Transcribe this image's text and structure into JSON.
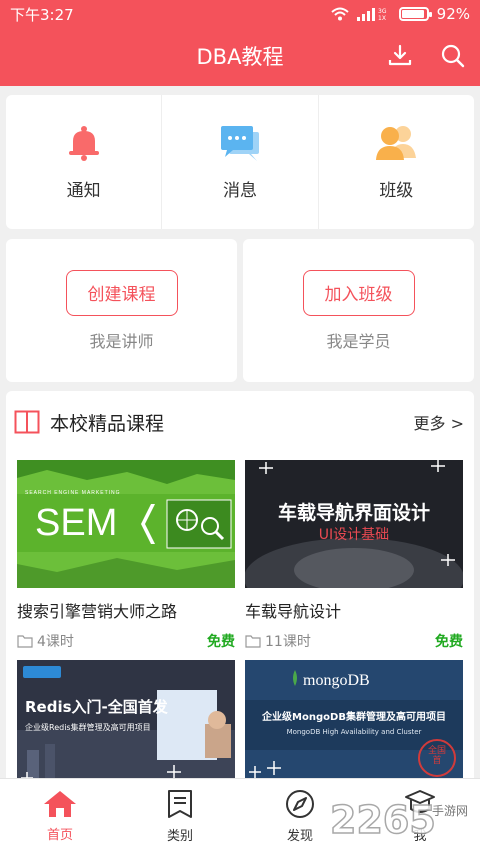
{
  "status": {
    "time": "下午3:27",
    "battery": "92%",
    "battery_level": 0.92
  },
  "header": {
    "title": "DBA教程",
    "download_icon": "download-icon",
    "search_icon": "search-icon"
  },
  "quick": [
    {
      "label": "通知",
      "icon": "bell-icon",
      "color": "#f96a6a"
    },
    {
      "label": "消息",
      "icon": "chat-icon",
      "color": "#5bb4f0"
    },
    {
      "label": "班级",
      "icon": "users-icon",
      "color": "#f9b04b"
    }
  ],
  "roles": [
    {
      "button": "创建课程",
      "sub": "我是讲师"
    },
    {
      "button": "加入班级",
      "sub": "我是学员"
    }
  ],
  "section": {
    "title": "本校精品课程",
    "more": "更多 >"
  },
  "courses": [
    {
      "title": "搜索引擎营销大师之路",
      "lessons": "4课时",
      "price": "免费",
      "banner_top": "SEARCH ENGINE MARKETING",
      "banner": "SEM"
    },
    {
      "title": "车载导航设计",
      "lessons": "11课时",
      "price": "免费",
      "banner": "车载导航界面设计",
      "banner_sub": "UI设计基础"
    },
    {
      "banner": "Redis入门-全国首发",
      "banner_sub": "企业级Redis集群管理及高可用项目"
    },
    {
      "banner_logo": "mongoDB",
      "banner": "企业级MongoDB集群管理及高可用项目",
      "banner_sub": "MongoDB High Availability and Cluster",
      "stamp": "全国首"
    }
  ],
  "nav": [
    {
      "label": "首页",
      "icon": "home-icon",
      "active": true
    },
    {
      "label": "类别",
      "icon": "list-icon",
      "active": false
    },
    {
      "label": "发现",
      "icon": "compass-icon",
      "active": false
    },
    {
      "label": "我",
      "icon": "profile-icon",
      "active": false
    }
  ],
  "watermark": {
    "text": "2265",
    "sub": "手游网"
  },
  "colors": {
    "accent": "#f4525b",
    "free": "#22aa22"
  }
}
